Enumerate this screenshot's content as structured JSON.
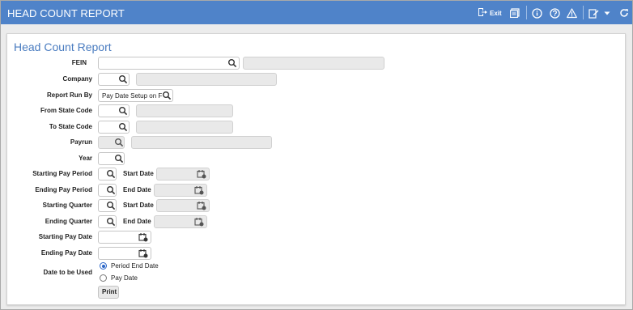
{
  "titlebar": {
    "title": "HEAD COUNT REPORT",
    "exit_label": "Exit"
  },
  "panel": {
    "title": "Head Count Report"
  },
  "fields": {
    "fein": "FEIN",
    "company": "Company",
    "report_run_by": "Report Run By",
    "report_run_by_value": "Pay Date Setup on F",
    "from_state_code": "From State Code",
    "to_state_code": "To State Code",
    "payrun": "Payrun",
    "year": "Year",
    "starting_pay_period": "Starting Pay Period",
    "start_date_1": "Start Date",
    "ending_pay_period": "Ending Pay Period",
    "end_date_1": "End Date",
    "starting_quarter": "Starting Quarter",
    "start_date_2": "Start Date",
    "ending_quarter": "Ending Quarter",
    "end_date_2": "End Date",
    "starting_pay_date": "Starting Pay Date",
    "ending_pay_date": "Ending Pay Date",
    "date_to_be_used": "Date to be Used"
  },
  "radio": {
    "option1": "Period End Date",
    "option2": "Pay Date",
    "selected": "Period End Date"
  },
  "print_label": "Print",
  "colors": {
    "titlebar": "#4f83c9",
    "panel_title": "#4a7cc0",
    "radio_selected": "#2a66c8"
  }
}
